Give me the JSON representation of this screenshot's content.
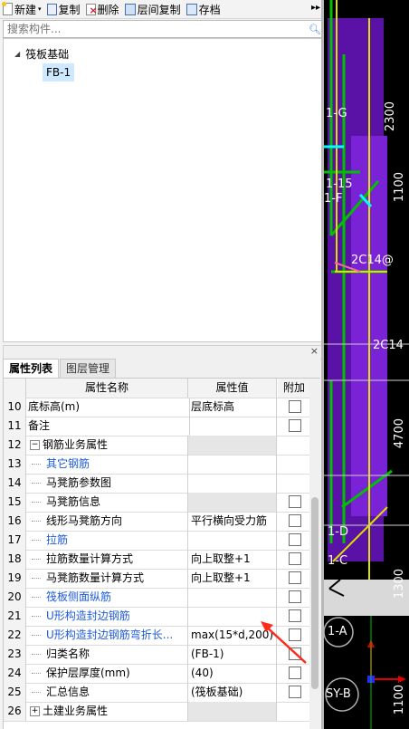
{
  "toolbar": {
    "new": "新建",
    "copy": "复制",
    "delete": "删除",
    "floor_copy": "层间复制",
    "save": "存档"
  },
  "search": {
    "placeholder": "搜索构件..."
  },
  "tree": {
    "root": "筏板基础",
    "child": "FB-1"
  },
  "tabs": {
    "properties": "属性列表",
    "layers": "图层管理"
  },
  "grid": {
    "headers": {
      "name": "属性名称",
      "value": "属性值",
      "add": "附加"
    },
    "rows": [
      {
        "num": "10",
        "name": "底标高(m)",
        "value": "层底标高",
        "check": true
      },
      {
        "num": "11",
        "name": "备注",
        "value": "",
        "check": true
      },
      {
        "num": "12",
        "name": "钢筋业务属性",
        "value": "",
        "check": false
      },
      {
        "num": "13",
        "name": "其它钢筋",
        "value": "",
        "check": false
      },
      {
        "num": "14",
        "name": "马凳筋参数图",
        "value": "",
        "check": false
      },
      {
        "num": "15",
        "name": "马凳筋信息",
        "value": "",
        "check": true
      },
      {
        "num": "16",
        "name": "线形马凳筋方向",
        "value": "平行横向受力筋",
        "check": true
      },
      {
        "num": "17",
        "name": "拉筋",
        "value": "",
        "check": true
      },
      {
        "num": "18",
        "name": "拉筋数量计算方式",
        "value": "向上取整+1",
        "check": true
      },
      {
        "num": "19",
        "name": "马凳筋数量计算方式",
        "value": "向上取整+1",
        "check": true
      },
      {
        "num": "20",
        "name": "筏板侧面纵筋",
        "value": "",
        "check": true
      },
      {
        "num": "21",
        "name": "U形构造封边钢筋",
        "value": "",
        "check": true
      },
      {
        "num": "22",
        "name": "U形构造封边钢筋弯折长...",
        "value": "max(15*d,200)",
        "check": true
      },
      {
        "num": "23",
        "name": "归类名称",
        "value": "(FB-1)",
        "check": true
      },
      {
        "num": "24",
        "name": "保护层厚度(mm)",
        "value": "(40)",
        "check": true
      },
      {
        "num": "25",
        "name": "汇总信息",
        "value": "(筏板基础)",
        "check": true
      },
      {
        "num": "26",
        "name": "土建业务属性",
        "value": "",
        "check": false
      }
    ]
  },
  "cad": {
    "labels": [
      "1-G",
      "2300",
      "1100",
      "1-15",
      "1-F",
      "2C14@",
      "2C14",
      "4700",
      "1-D",
      "1-C",
      "1300",
      "1-A",
      "SY-B",
      "1100"
    ]
  }
}
